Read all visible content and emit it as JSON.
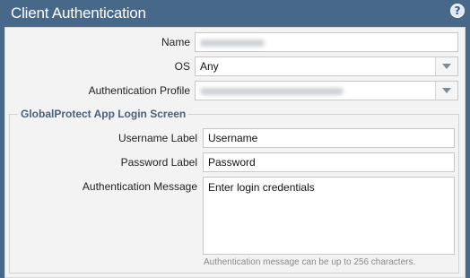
{
  "dialog": {
    "title": "Client Authentication"
  },
  "form": {
    "name_label": "Name",
    "name_value": "",
    "os_label": "OS",
    "os_value": "Any",
    "auth_profile_label": "Authentication Profile",
    "auth_profile_value": ""
  },
  "login_screen": {
    "legend": "GlobalProtect App Login Screen",
    "username_label": "Username Label",
    "username_value": "Username",
    "password_label": "Password Label",
    "password_value": "Password",
    "auth_message_label": "Authentication Message",
    "auth_message_value": "Enter login credentials",
    "auth_message_hint": "Authentication message can be up to 256 characters."
  },
  "colors": {
    "titlebar": "#486889",
    "panel": "#f3f3f3",
    "legend_text": "#4a6178"
  },
  "icons": {
    "help": "help-icon",
    "dropdown": "chevron-down-icon"
  }
}
